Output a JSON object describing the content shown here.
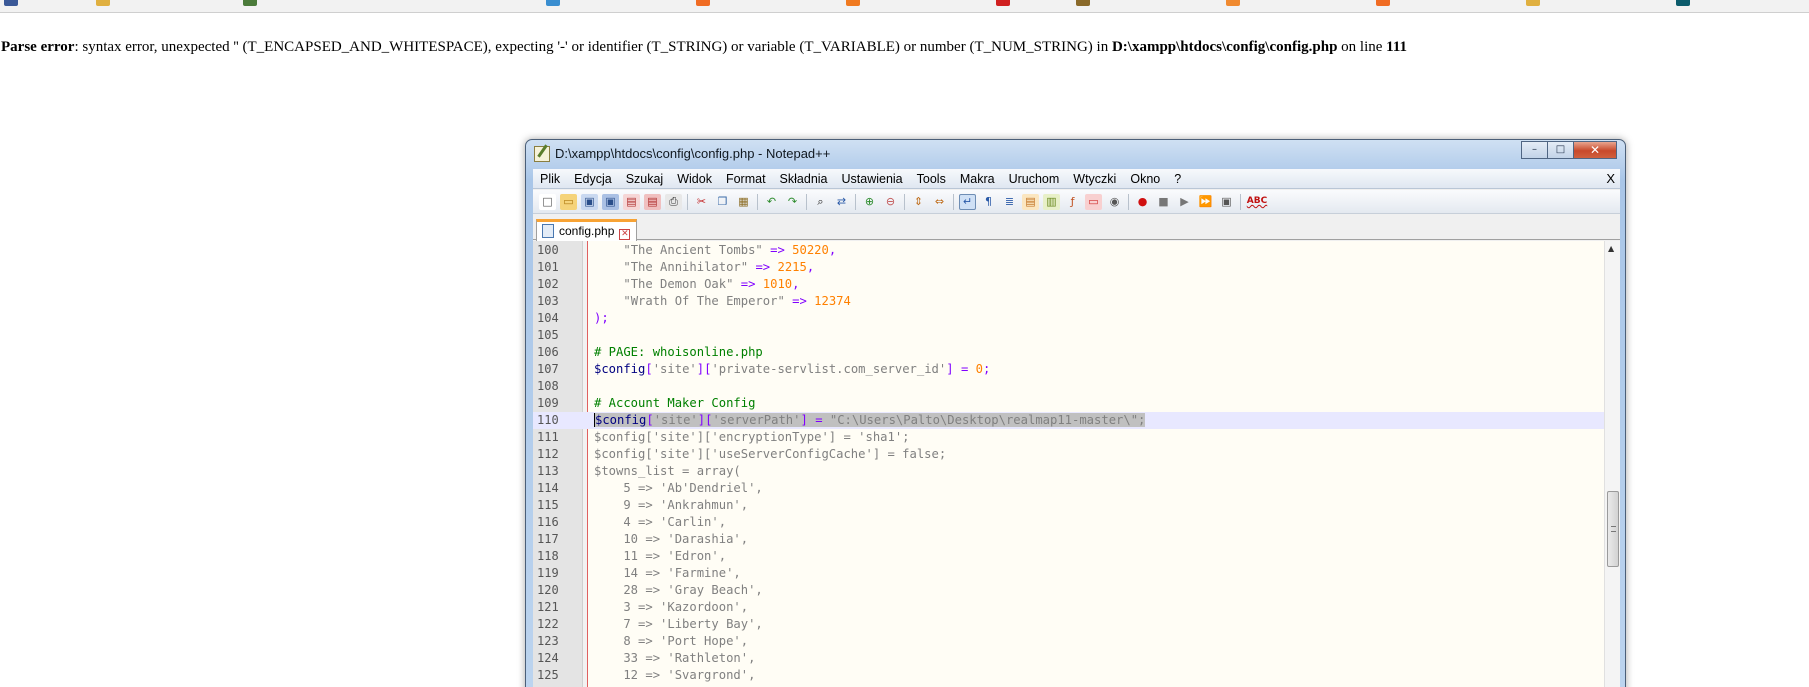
{
  "error": {
    "label": "Parse error",
    "message": ": syntax error, unexpected '' (T_ENCAPSED_AND_WHITESPACE), expecting '-' or identifier (T_STRING) or variable (T_VARIABLE) or number (T_NUM_STRING) in ",
    "file": "D:\\xampp\\htdocs\\config\\config.php",
    "on_line_text": " on line ",
    "line": "111"
  },
  "window": {
    "title": "D:\\xampp\\htdocs\\config\\config.php - Notepad++",
    "minimize_glyph": "–",
    "maximize_glyph": "□",
    "close_glyph": "✕"
  },
  "menu": [
    "Plik",
    "Edycja",
    "Szukaj",
    "Widok",
    "Format",
    "Składnia",
    "Ustawienia",
    "Tools",
    "Makra",
    "Uruchom",
    "Wtyczki",
    "Okno",
    "?"
  ],
  "menu_close": "X",
  "toolbar": {
    "icons": [
      "new-file-icon",
      "open-file-icon",
      "save-icon",
      "save-all-icon",
      "close-icon",
      "close-all-icon",
      "print-icon",
      "|",
      "cut-icon",
      "copy-icon",
      "paste-icon",
      "|",
      "undo-icon",
      "redo-icon",
      "|",
      "find-icon",
      "replace-icon",
      "|",
      "zoom-in-icon",
      "zoom-out-icon",
      "|",
      "sync-vertical-icon",
      "sync-horizontal-icon",
      "|",
      "word-wrap-icon",
      "show-all-chars-icon",
      "indent-guide-icon",
      "user-defined-lang-icon",
      "doc-map-icon",
      "function-list-icon",
      "folder-workspace-icon",
      "monitoring-icon",
      "|",
      "record-macro-icon",
      "stop-record-icon",
      "play-macro-icon",
      "run-macro-multiple-icon",
      "save-macro-icon",
      "|",
      "spell-check-icon"
    ]
  },
  "tab": {
    "label": "config.php",
    "close_glyph": "✕"
  },
  "editor": {
    "lines": [
      {
        "n": "100",
        "html": "    <span class=\"str\">\"The Ancient Tombs\"</span> <span class=\"kw\">=&gt;</span> <span class=\"num\">50220</span><span class=\"kw\">,</span>"
      },
      {
        "n": "101",
        "html": "    <span class=\"str\">\"The Annihilator\"</span> <span class=\"kw\">=&gt;</span> <span class=\"num\">2215</span><span class=\"kw\">,</span>"
      },
      {
        "n": "102",
        "html": "    <span class=\"str\">\"The Demon Oak\"</span> <span class=\"kw\">=&gt;</span> <span class=\"num\">1010</span><span class=\"kw\">,</span>"
      },
      {
        "n": "103",
        "html": "    <span class=\"str\">\"Wrath Of The Emperor\"</span> <span class=\"kw\">=&gt;</span> <span class=\"num\">12374</span>"
      },
      {
        "n": "104",
        "html": "<span class=\"kw\">);</span>"
      },
      {
        "n": "105",
        "html": ""
      },
      {
        "n": "106",
        "html": "<span class=\"com\"># PAGE: whoisonline.php</span>"
      },
      {
        "n": "107",
        "html": "<span class=\"var\">$config</span><span class=\"kw\">[</span><span class=\"str\">'site'</span><span class=\"kw\">][</span><span class=\"str\">'private-servlist.com_server_id'</span><span class=\"kw\">]</span> <span class=\"kw\">=</span> <span class=\"num\">0</span><span class=\"kw\">;</span>"
      },
      {
        "n": "108",
        "html": ""
      },
      {
        "n": "109",
        "html": "<span class=\"com\"># Account Maker Config</span>"
      },
      {
        "n": "110",
        "current": true,
        "html": "<span class=\"sel\"><span class=\"caret\"></span><span class=\"var\">$config</span><span class=\"kw\">[</span><span class=\"str\">'site'</span><span class=\"kw\">][</span><span class=\"str\">'serverPath'</span><span class=\"kw\">]</span> <span class=\"kw\">=</span> <span class=\"str\">\"C:\\Users\\Palto\\Desktop\\realmap11-master\\\";</span></span>"
      },
      {
        "n": "111",
        "html": "<span class=\"str\">$config['site']['encryptionType'] = 'sha1';</span>"
      },
      {
        "n": "112",
        "html": "<span class=\"str\">$config['site']['useServerConfigCache'] = false;</span>"
      },
      {
        "n": "113",
        "html": "<span class=\"str\">$towns_list = array(</span>"
      },
      {
        "n": "114",
        "html": "<span class=\"str\">    5 =&gt; 'Ab'Dendriel',</span>"
      },
      {
        "n": "115",
        "html": "<span class=\"str\">    9 =&gt; 'Ankrahmun',</span>"
      },
      {
        "n": "116",
        "html": "<span class=\"str\">    4 =&gt; 'Carlin',</span>"
      },
      {
        "n": "117",
        "html": "<span class=\"str\">    10 =&gt; 'Darashia',</span>"
      },
      {
        "n": "118",
        "html": "<span class=\"str\">    11 =&gt; 'Edron',</span>"
      },
      {
        "n": "119",
        "html": "<span class=\"str\">    14 =&gt; 'Farmine',</span>"
      },
      {
        "n": "120",
        "html": "<span class=\"str\">    28 =&gt; 'Gray Beach',</span>"
      },
      {
        "n": "121",
        "html": "<span class=\"str\">    3 =&gt; 'Kazordoon',</span>"
      },
      {
        "n": "122",
        "html": "<span class=\"str\">    7 =&gt; 'Liberty Bay',</span>"
      },
      {
        "n": "123",
        "html": "<span class=\"str\">    8 =&gt; 'Port Hope',</span>"
      },
      {
        "n": "124",
        "html": "<span class=\"str\">    33 =&gt; 'Rathleton',</span>"
      },
      {
        "n": "125",
        "html": "<span class=\"str\">    12 =&gt; 'Svargrond',</span>"
      }
    ]
  },
  "colors": {
    "keyword": "#8000ff",
    "string": "#808080",
    "number": "#ff8000",
    "comment": "#008000",
    "variable": "#000080",
    "current_line": "#e8e8ff",
    "tab_accent": "#f8a334"
  }
}
